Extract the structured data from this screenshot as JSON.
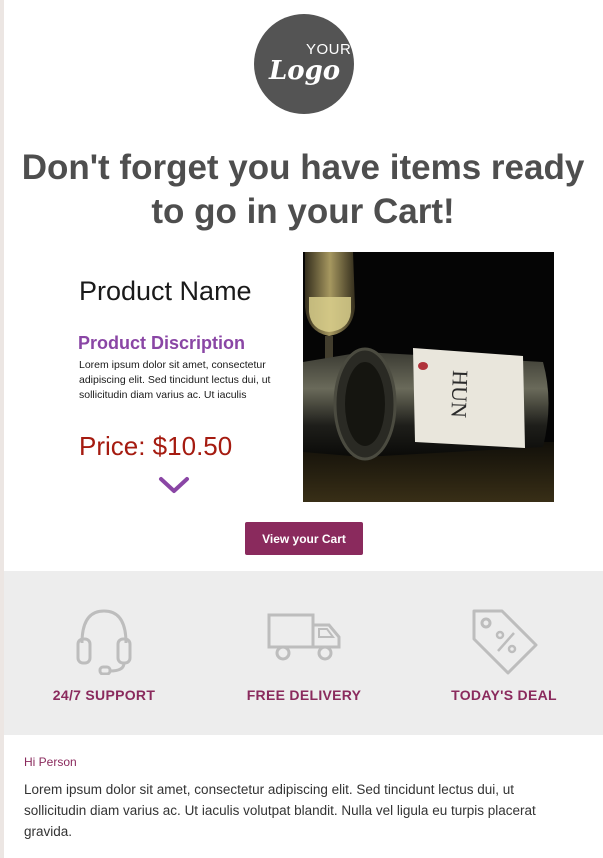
{
  "logo": {
    "top_text": "YOUR",
    "word": "Logo"
  },
  "headline": "Don't forget you have items ready to go in your Cart!",
  "product": {
    "name": "Product Name",
    "description_title": "Product Discription",
    "description": "Lorem ipsum dolor sit amet, consectetur adipiscing elit. Sed tincidunt lectus dui, ut sollicitudin diam varius ac. Ut iaculis",
    "price": "Price: $10.50",
    "bottle_label": "HUN"
  },
  "cta": {
    "label": "View your Cart"
  },
  "features": [
    {
      "label": "24/7 SUPPORT",
      "icon": "headset-icon"
    },
    {
      "label": "FREE DELIVERY",
      "icon": "delivery-truck-icon"
    },
    {
      "label": "TODAY'S DEAL",
      "icon": "price-tag-icon"
    }
  ],
  "message": {
    "greeting": "Hi Person",
    "body": "Lorem ipsum dolor sit amet, consectetur adipiscing elit. Sed tincidunt lectus dui, ut sollicitudin diam varius ac. Ut iaculis volutpat blandit. Nulla vel ligula eu turpis placerat gravida."
  },
  "colors": {
    "heading": "#4e4e4e",
    "accent_purple": "#8a46a5",
    "brand_plum": "#8a2a5d",
    "price_red": "#a51b10",
    "feature_band": "#ededed"
  }
}
